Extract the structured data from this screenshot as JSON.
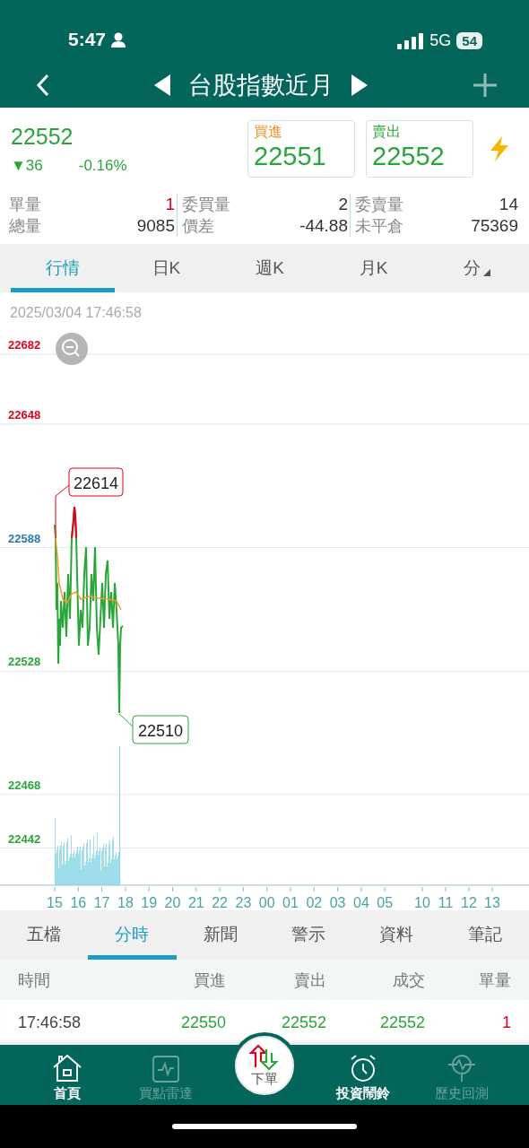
{
  "status_bar": {
    "time": "5:47",
    "network": "5G",
    "battery": "54"
  },
  "header": {
    "title": "台股指數近月"
  },
  "quote": {
    "price": "22552",
    "change": "▼36",
    "change_percent": "-0.16%",
    "bid": {
      "label": "買進",
      "value": "22551"
    },
    "ask": {
      "label": "賣出",
      "value": "22552"
    }
  },
  "stats": [
    {
      "label": "單量",
      "value": "1",
      "color": "#e0001b"
    },
    {
      "label": "委買量",
      "value": "2",
      "color": "#333333"
    },
    {
      "label": "委賣量",
      "value": "14",
      "color": "#333333"
    },
    {
      "label": "總量",
      "value": "9085",
      "color": "#333333"
    },
    {
      "label": "價差",
      "value": "-44.88",
      "color": "#333333"
    },
    {
      "label": "未平倉",
      "value": "75369",
      "color": "#333333"
    }
  ],
  "chart_tabs": [
    {
      "label": "行情",
      "selected": true
    },
    {
      "label": "日K",
      "selected": false
    },
    {
      "label": "週K",
      "selected": false
    },
    {
      "label": "月K",
      "selected": false
    },
    {
      "label": "分",
      "selected": false,
      "dropdown": true
    }
  ],
  "chart": {
    "timestamp": "2025/03/04 17:46:58",
    "y_labels": [
      {
        "text": "22682",
        "color": "#e0001b"
      },
      {
        "text": "22648",
        "color": "#e0001b"
      },
      {
        "text": "22588",
        "color": "#2a78b0"
      },
      {
        "text": "22528",
        "color": "#2aa53a"
      },
      {
        "text": "22468",
        "color": "#2aa53a"
      },
      {
        "text": "22442",
        "color": "#2aa53a"
      }
    ],
    "x_labels": [
      "15",
      "16",
      "17",
      "18",
      "19",
      "20",
      "21",
      "22",
      "23",
      "00",
      "01",
      "02",
      "03",
      "04",
      "05",
      "10",
      "11",
      "12",
      "13"
    ],
    "high_callout": "22614",
    "low_callout": "22510"
  },
  "detail_tabs": [
    {
      "label": "五檔",
      "selected": false
    },
    {
      "label": "分時",
      "selected": true
    },
    {
      "label": "新聞",
      "selected": false
    },
    {
      "label": "警示",
      "selected": false
    },
    {
      "label": "資料",
      "selected": false
    },
    {
      "label": "筆記",
      "selected": false
    }
  ],
  "table": {
    "columns": [
      "時間",
      "買進",
      "賣出",
      "成交",
      "單量"
    ],
    "rows": [
      {
        "cells": [
          {
            "text": "17:46:58",
            "color": "#444444"
          },
          {
            "text": "22550",
            "color": "#2aa53a"
          },
          {
            "text": "22552",
            "color": "#2aa53a"
          },
          {
            "text": "22552",
            "color": "#2aa53a"
          },
          {
            "text": "1",
            "color": "#e0001b"
          }
        ]
      }
    ]
  },
  "bottom_nav": [
    {
      "label": "首頁",
      "kind": "home",
      "dimmed": false
    },
    {
      "label": "買點雷達",
      "kind": "radar",
      "dimmed": true
    },
    {
      "label": "下單",
      "kind": "order"
    },
    {
      "label": "投資鬧鈴",
      "kind": "alarm",
      "dimmed": false
    },
    {
      "label": "歷史回測",
      "kind": "backtest",
      "dimmed": true
    }
  ]
}
